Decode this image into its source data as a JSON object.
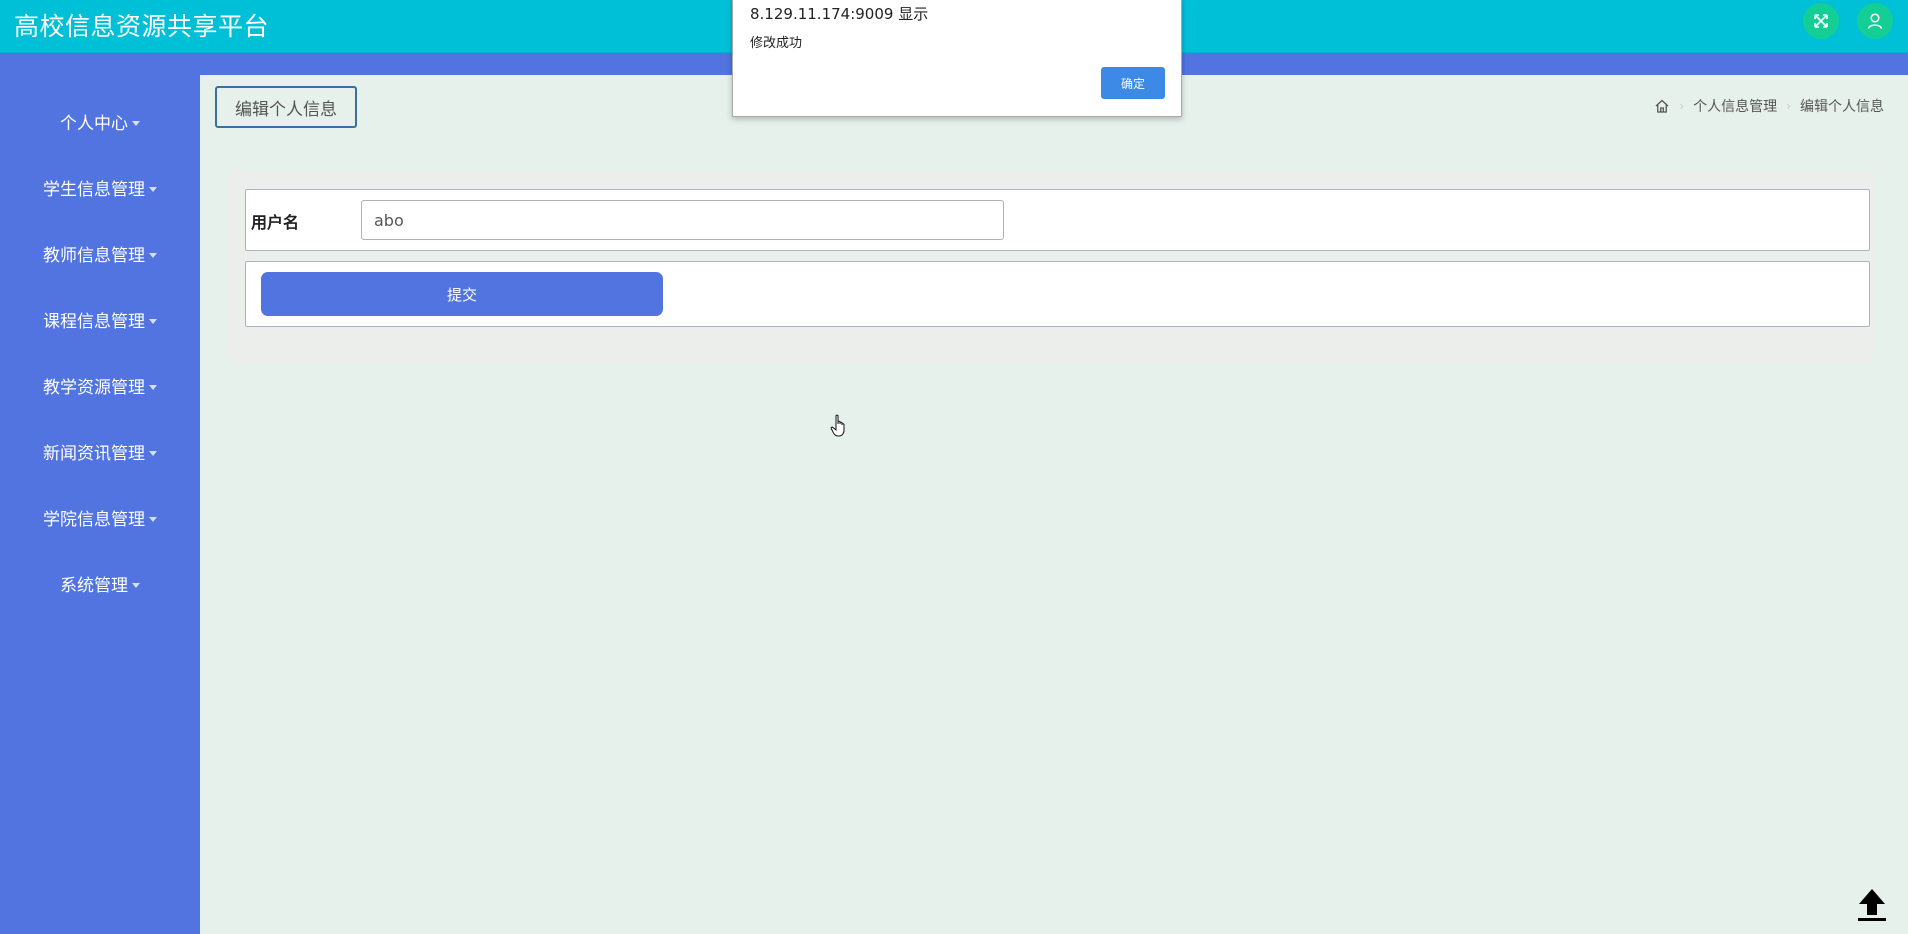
{
  "header": {
    "title": "高校信息资源共享平台",
    "accent_color": "#00c0d8",
    "buttons": [
      {
        "icon": "fullscreen-icon"
      },
      {
        "icon": "user-icon"
      }
    ]
  },
  "sidebar": {
    "background": "#5174e0",
    "items": [
      {
        "label": "个人中心"
      },
      {
        "label": "学生信息管理"
      },
      {
        "label": "教师信息管理"
      },
      {
        "label": "课程信息管理"
      },
      {
        "label": "教学资源管理"
      },
      {
        "label": "新闻资讯管理"
      },
      {
        "label": "学院信息管理"
      },
      {
        "label": "系统管理"
      }
    ]
  },
  "page": {
    "tab_title": "编辑个人信息"
  },
  "breadcrumb": {
    "items": [
      "个人信息管理",
      "编辑个人信息"
    ]
  },
  "form": {
    "username_label": "用户名",
    "username_value": "abo",
    "submit_label": "提交"
  },
  "dialog": {
    "title": "8.129.11.174:9009 显示",
    "message": "修改成功",
    "ok_label": "确定"
  }
}
